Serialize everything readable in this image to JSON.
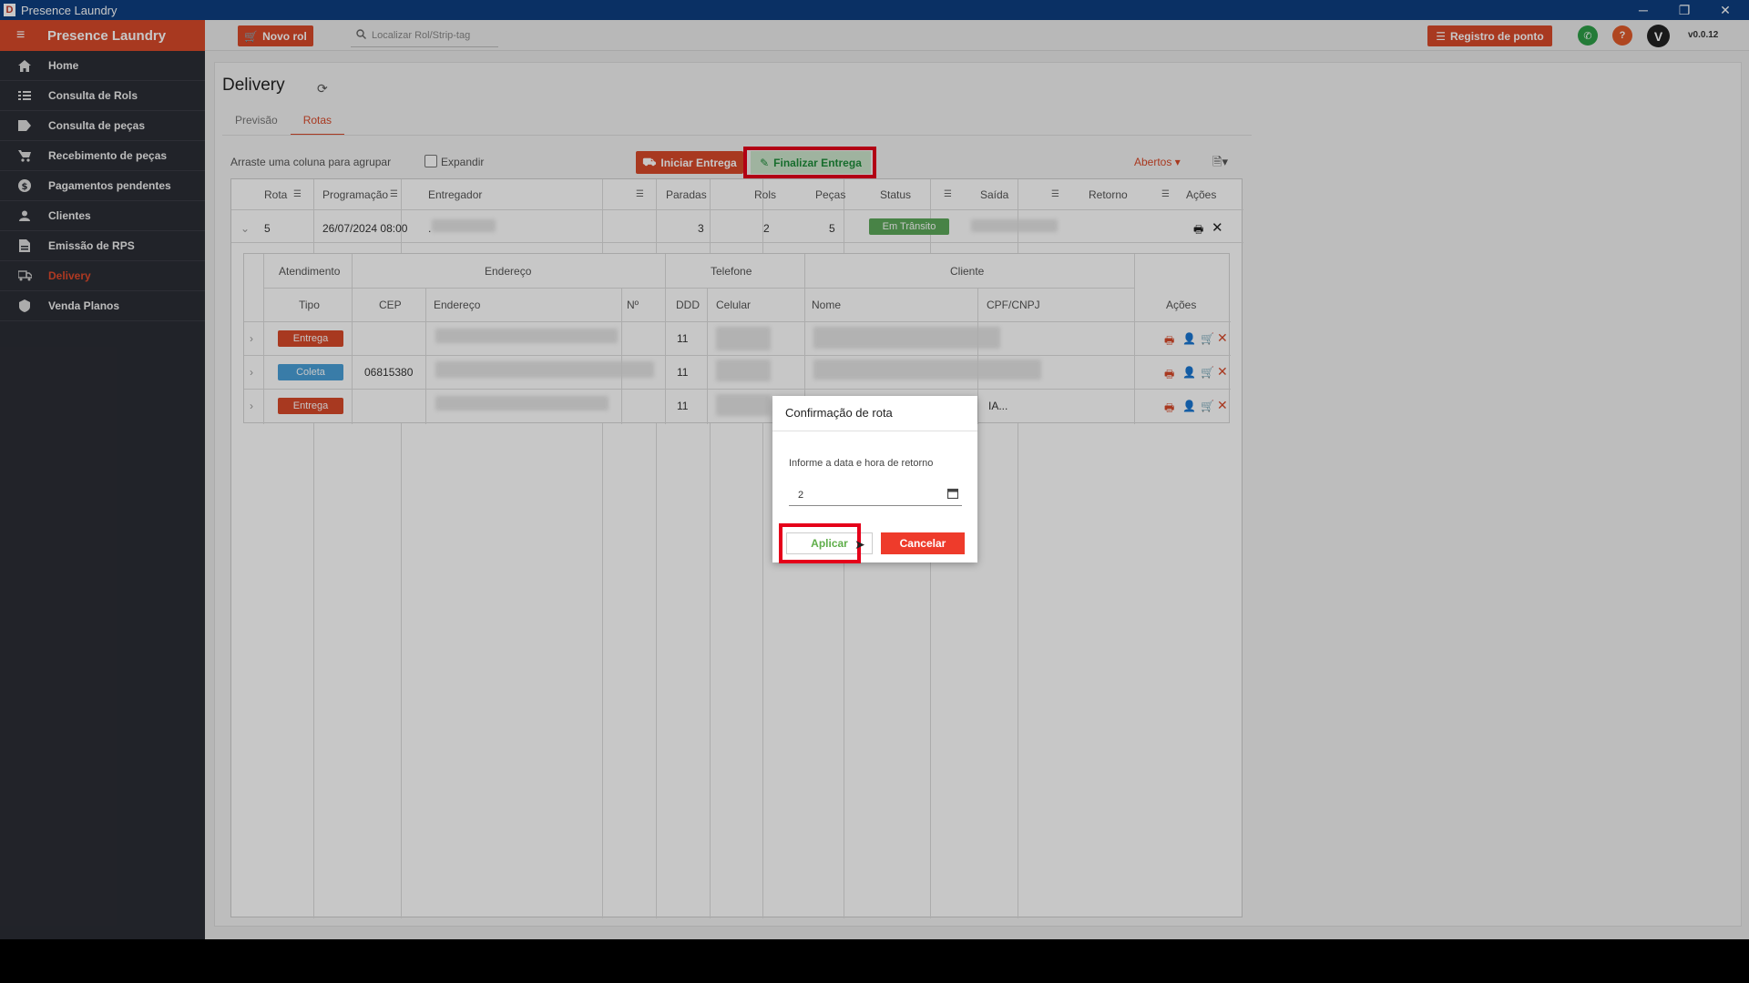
{
  "window": {
    "title": "Presence Laundry",
    "app_icon": "D",
    "minimize": "─",
    "restore": "❐",
    "close": "✕"
  },
  "sidebar": {
    "brand": "Presence Laundry",
    "items": [
      {
        "label": "Home",
        "icon": "home-icon"
      },
      {
        "label": "Consulta de Rols",
        "icon": "list-icon"
      },
      {
        "label": "Consulta de peças",
        "icon": "tag-icon"
      },
      {
        "label": "Recebimento de peças",
        "icon": "cart-icon"
      },
      {
        "label": "Pagamentos pendentes",
        "icon": "dollar-icon"
      },
      {
        "label": "Clientes",
        "icon": "person-icon"
      },
      {
        "label": "Emissão de RPS",
        "icon": "document-icon"
      },
      {
        "label": "Delivery",
        "icon": "delivery-icon"
      },
      {
        "label": "Venda Planos",
        "icon": "plan-icon"
      }
    ]
  },
  "topbar": {
    "new_rol": "Novo rol",
    "search_placeholder": "Localizar Rol/Strip-tag",
    "registro": "Registro de ponto",
    "avatar": "V",
    "version": "v0.0.12",
    "colors": {
      "accent": "#d8492a",
      "whatsapp": "#2e9e47",
      "help": "#e05a2a",
      "avatar": "#222222"
    }
  },
  "page": {
    "title": "Delivery",
    "tabs": [
      "Previsão",
      "Rotas"
    ],
    "active_tab": "Rotas",
    "group_hint": "Arraste uma coluna para agrupar",
    "expand_label": "Expandir",
    "iniciar": "Iniciar Entrega",
    "finalizar": "Finalizar Entrega",
    "abertos": "Abertos"
  },
  "grid": {
    "headers": [
      "Rota",
      "Programação",
      "Entregador",
      "Paradas",
      "Rols",
      "Peças",
      "Status",
      "Saída",
      "Retorno",
      "Ações"
    ],
    "row": {
      "rota": "5",
      "programacao": "26/07/2024 08:00",
      "entregador": ".",
      "paradas": "3",
      "rols": "2",
      "pecas": "5",
      "status": "Em Trânsito"
    }
  },
  "subgrid": {
    "group_headers": [
      "Atendimento",
      "Endereço",
      "Telefone",
      "Cliente"
    ],
    "headers": [
      "Tipo",
      "CEP",
      "Endereço",
      "Nº",
      "DDD",
      "Celular",
      "Nome",
      "CPF/CNPJ",
      "Ações"
    ],
    "rows": [
      {
        "tipo": "Entrega",
        "cep": "",
        "ddd": "11",
        "color": "#d8492a"
      },
      {
        "tipo": "Coleta",
        "cep": "06815380",
        "ddd": "11",
        "color": "#4a9fd8"
      },
      {
        "tipo": "Entrega",
        "cep": "",
        "ddd": "11",
        "color": "#d8492a"
      }
    ],
    "row3_nome_fragment": "IA..."
  },
  "dialog": {
    "title": "Confirmação de rota",
    "label": "Informe a data e hora de retorno",
    "value": "2",
    "aplicar": "Aplicar",
    "cancelar": "Cancelar"
  }
}
